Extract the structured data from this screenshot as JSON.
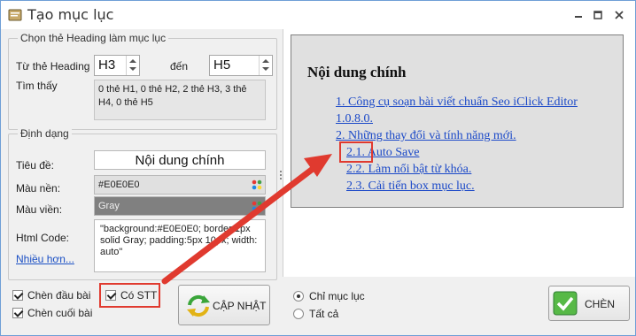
{
  "window": {
    "title": "Tạo mục lục"
  },
  "heading_group": {
    "title": "Chọn thẻ Heading làm mục lục",
    "from_label": "Từ thẻ Heading",
    "from_value": "H3",
    "to_label": "đến",
    "to_value": "H5",
    "found_label": "Tìm thấy",
    "found_text": "0 thẻ H1, 0 thẻ H2, 2 thẻ H3, 3 thẻ H4, 0 thẻ H5"
  },
  "format_group": {
    "title": "Định dạng",
    "title_label": "Tiêu đề:",
    "title_value": "Nội dung chính",
    "bg_label": "Màu nền:",
    "bg_value": "#E0E0E0",
    "border_label": "Màu viền:",
    "border_value": "Gray",
    "html_label": "Html Code:",
    "html_value": "\"background:#E0E0E0; border:1px solid Gray; padding:5px 10px; width: auto\"",
    "more_link": "Nhiều hơn..."
  },
  "options": {
    "insert_top": "Chèn đầu bài",
    "insert_bottom": "Chèn cuối bài",
    "numbering": "Có STT",
    "insert_top_checked": true,
    "insert_bottom_checked": true,
    "numbering_checked": true
  },
  "update_button": "CẬP NHẬT",
  "preview": {
    "title": "Nội dung chính",
    "items": [
      "1. Công cụ soạn bài viết chuẩn Seo iClick Editor",
      "1.0.8.0.",
      "2. Những thay đổi và tính năng mới.",
      "2.1. Auto Save",
      "2.2. Làm nổi bật từ khóa.",
      "2.3. Cải tiến box mục lục."
    ]
  },
  "insert_mode": {
    "only_toc": "Chỉ mục lục",
    "all": "Tất cả",
    "selected": "only_toc"
  },
  "insert_button": "CHÈN",
  "colors": {
    "accent_red": "#e03a2f",
    "link_blue": "#1b49c8",
    "preview_bg": "#E0E0E0"
  }
}
